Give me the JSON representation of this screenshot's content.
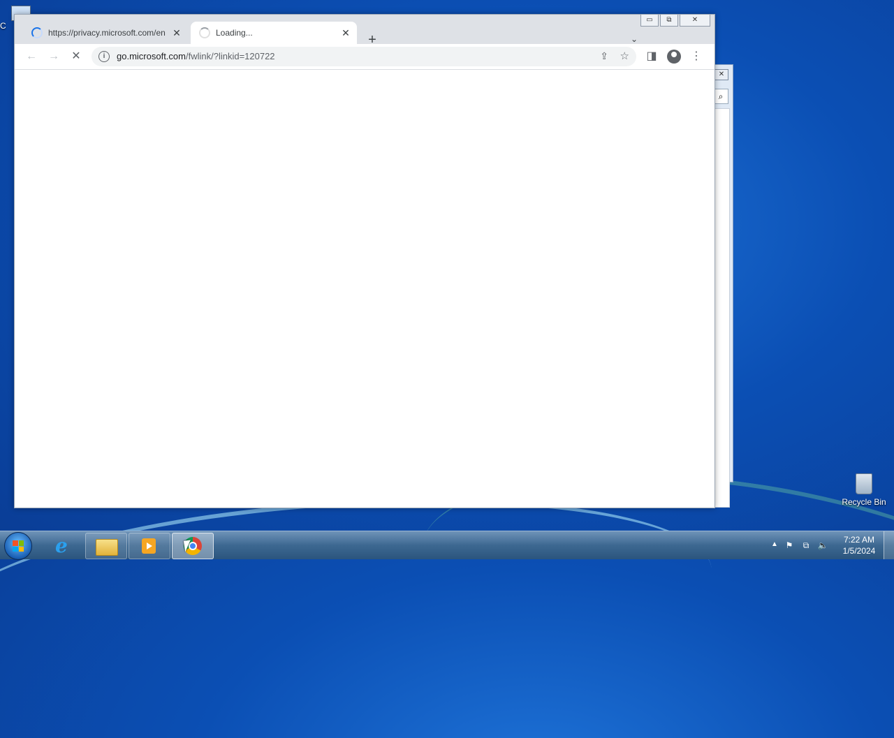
{
  "desktop": {
    "recycle_bin_label": "Recycle Bin",
    "computer_label_partial": "C"
  },
  "browser": {
    "tabs": [
      {
        "title": "https://privacy.microsoft.com/en",
        "loading": true,
        "active": false
      },
      {
        "title": "Loading...",
        "loading": true,
        "active": true
      }
    ],
    "new_tab_glyph": "+",
    "tab_search_glyph": "⌄",
    "url_host": "go.microsoft.com",
    "url_rest": "/fwlink/?linkid=120722",
    "window_buttons": {
      "minimize": "▭",
      "restore": "⧉",
      "close": "✕"
    },
    "nav": {
      "back": "←",
      "forward": "→",
      "stop": "✕",
      "info": "i",
      "share": "⇪",
      "bookmark": "☆",
      "side_panel": "◨",
      "menu": "⋮"
    }
  },
  "taskbar": {
    "apps": [
      "start",
      "internet-explorer",
      "file-explorer",
      "media-player",
      "chrome"
    ],
    "active_app": "chrome",
    "tray_icons": {
      "expand": "▲",
      "action_center": "⚑",
      "network": "⧉",
      "volume": "🔈"
    },
    "clock_time": "7:22 AM",
    "clock_date": "1/5/2024"
  }
}
